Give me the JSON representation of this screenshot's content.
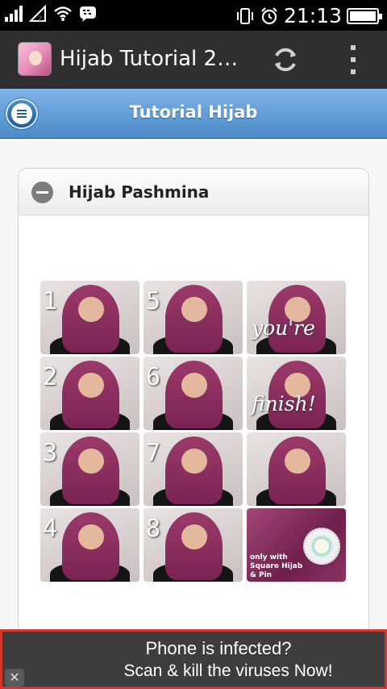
{
  "status_bar": {
    "time": "21:13",
    "signal_strength": 4,
    "battery_level": 1.0,
    "icons": [
      "signal-icon",
      "mobile-data-icon",
      "wifi-icon",
      "bbm-icon",
      "vibrate-icon",
      "alarm-icon",
      "battery-icon"
    ]
  },
  "action_bar": {
    "app_title": "Hijab Tutorial 2…",
    "refresh_icon": "refresh-icon",
    "menu_icon": "overflow-menu-icon"
  },
  "header": {
    "title": "Tutorial Hijab",
    "panel_icon": "menu-icon"
  },
  "collapsible": {
    "title": "Hijab Pashmina",
    "icon": "minus-icon"
  },
  "tutorial_image": {
    "steps": [
      "1",
      "2",
      "3",
      "4",
      "5",
      "6",
      "7",
      "8"
    ],
    "captions": [
      "you're",
      "finish!"
    ],
    "note_lines": [
      "only with",
      "Square Hijab",
      "& Pin"
    ]
  },
  "ad_banner": {
    "line1": "Phone is infected?",
    "line2": "Scan & kill the viruses Now!",
    "close_label": "✕"
  },
  "colors": {
    "header_blue": "#4a8ac8",
    "action_bar": "#2f2f2f",
    "ad_border": "#d8332a",
    "scarf": "#8c2c5c"
  }
}
